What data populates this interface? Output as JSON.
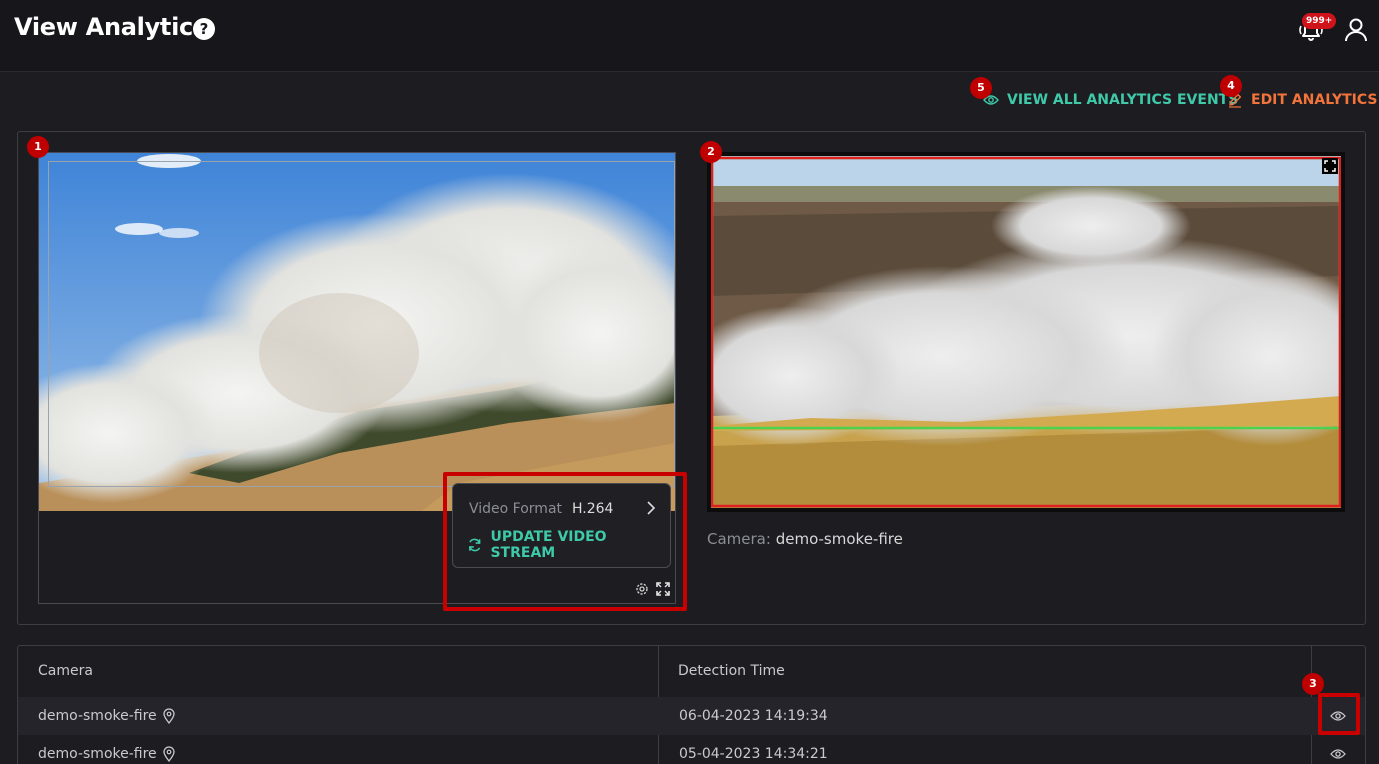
{
  "header": {
    "title": "View Analytics",
    "help_glyph": "?",
    "notification_badge": "999+",
    "icons": [
      "help-icon",
      "notification-bell-icon",
      "user-icon"
    ]
  },
  "actions": {
    "view_all_label": "VIEW ALL ANALYTICS EVENTS",
    "edit_label": "EDIT ANALYTICS",
    "view_color": "#3ec9a8",
    "edit_color": "#f2743a"
  },
  "markers": [
    "1",
    "2",
    "3",
    "4",
    "5"
  ],
  "player": {
    "menu": {
      "format_label": "Video Format",
      "format_value": "H.264",
      "update_label": "UPDATE VIDEO STREAM"
    }
  },
  "snapshot": {
    "caption_label": "Camera:",
    "camera_name": "demo-smoke-fire"
  },
  "table": {
    "columns": [
      "Camera",
      "Detection Time"
    ],
    "rows": [
      {
        "camera": "demo-smoke-fire",
        "time": "06-04-2023 14:19:34"
      },
      {
        "camera": "demo-smoke-fire",
        "time": "05-04-2023 14:34:21"
      }
    ]
  },
  "colors": {
    "background": "#1c1c21",
    "accent_teal": "#3ec9a8",
    "accent_orange": "#f2743a",
    "highlight_red": "#c80000",
    "zone_green": "#4cd24c",
    "zone_red": "#e02020"
  }
}
